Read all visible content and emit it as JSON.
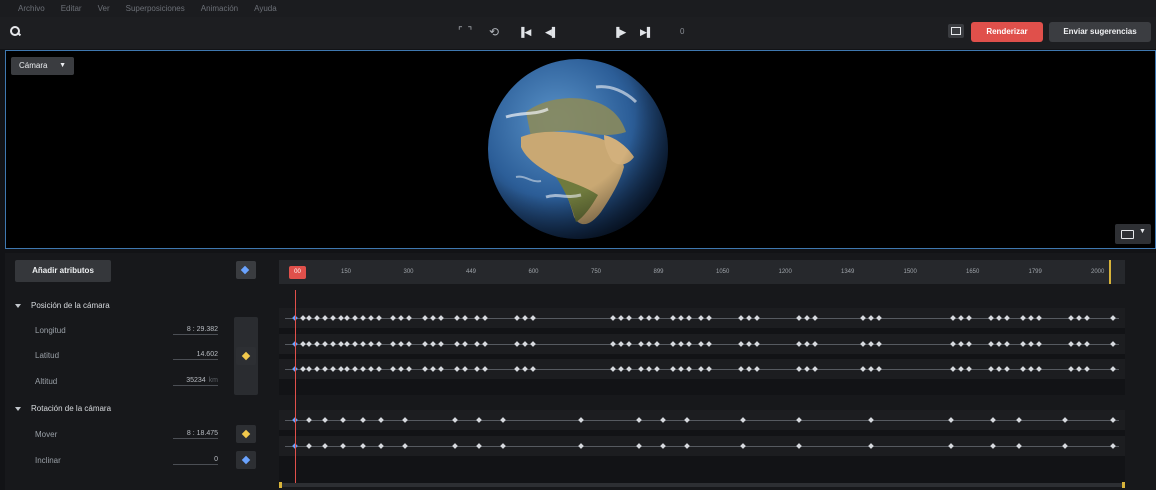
{
  "menu": [
    "Archivo",
    "Editar",
    "Ver",
    "Superposiciones",
    "Animación",
    "Ayuda"
  ],
  "toolbar": {
    "frame_counter": "0",
    "render_label": "Renderizar",
    "feedback_label": "Enviar sugerencias",
    "icons": [
      "search-icon",
      "fullscreen-icon",
      "loop-icon",
      "skip-first-icon",
      "prev-frame-icon",
      "play-icon",
      "next-frame-icon",
      "skip-last-icon",
      "snapshot-icon"
    ]
  },
  "viewport": {
    "camera_label": "Cámara",
    "border_color": "#3f78b0"
  },
  "panel": {
    "add_attrs_label": "Añadir atributos",
    "groups": [
      {
        "title": "Posición de la cámara",
        "attrs": [
          {
            "label": "Longitud",
            "value": "8 : 29.382"
          },
          {
            "label": "Latitud",
            "value": "14.602"
          },
          {
            "label": "Altitud",
            "value": "35234",
            "unit": "km"
          }
        ]
      },
      {
        "title": "Rotación de la cámara",
        "attrs": [
          {
            "label": "Mover",
            "value": "8 : 18.475"
          },
          {
            "label": "Inclinar",
            "value": "0"
          }
        ]
      }
    ]
  },
  "timeline": {
    "playhead_label": "00",
    "ticks": [
      "150",
      "300",
      "449",
      "600",
      "750",
      "899",
      "1050",
      "1200",
      "1349",
      "1500",
      "1650",
      "1799",
      "2000"
    ],
    "accent": "#e0504b",
    "keyframe_color": "#d6d9de"
  }
}
